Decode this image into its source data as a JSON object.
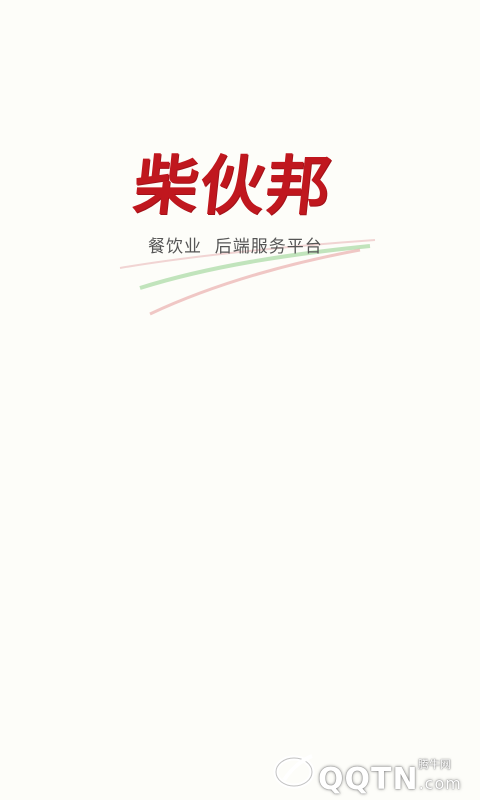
{
  "splash": {
    "brand_name": "柴伙邦",
    "tagline": "餐饮业  后端服务平台",
    "colors": {
      "background": "#fdfdf9",
      "brand_red": "#c0171e",
      "tagline_gray": "#555555",
      "swoosh_green": "#8fcf8a",
      "swoosh_red": "#e59a9a"
    }
  },
  "watermark": {
    "site_name": "腾牛网",
    "logo_text": "QQTN",
    "logo_suffix": ".com",
    "icon": "qqtn-logo-icon"
  }
}
